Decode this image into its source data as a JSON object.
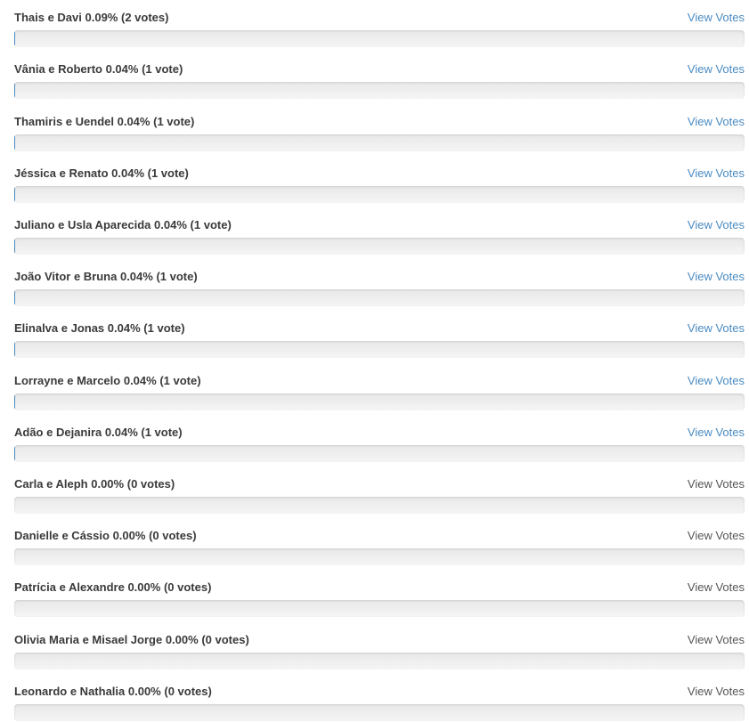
{
  "view_votes_label": "View Votes",
  "colors": {
    "link": "#4a8bc2",
    "disabled_link": "#555555",
    "label": "#3a3a3a",
    "bar_bg": "#eeeeee"
  },
  "options": [
    {
      "name": "Thais e Davi",
      "percent_text": "0.09%",
      "votes_text": "(2 votes)",
      "percent": 0.09,
      "has_votes": true
    },
    {
      "name": "Vânia e Roberto",
      "percent_text": "0.04%",
      "votes_text": "(1 vote)",
      "percent": 0.04,
      "has_votes": true
    },
    {
      "name": "Thamiris e Uendel",
      "percent_text": "0.04%",
      "votes_text": "(1 vote)",
      "percent": 0.04,
      "has_votes": true
    },
    {
      "name": "Jéssica e Renato",
      "percent_text": "0.04%",
      "votes_text": "(1 vote)",
      "percent": 0.04,
      "has_votes": true
    },
    {
      "name": "Juliano e Usla Aparecida",
      "percent_text": "0.04%",
      "votes_text": "(1 vote)",
      "percent": 0.04,
      "has_votes": true
    },
    {
      "name": "João Vitor e Bruna",
      "percent_text": "0.04%",
      "votes_text": "(1 vote)",
      "percent": 0.04,
      "has_votes": true
    },
    {
      "name": "Elinalva e Jonas",
      "percent_text": "0.04%",
      "votes_text": "(1 vote)",
      "percent": 0.04,
      "has_votes": true
    },
    {
      "name": "Lorrayne e Marcelo",
      "percent_text": "0.04%",
      "votes_text": "(1 vote)",
      "percent": 0.04,
      "has_votes": true
    },
    {
      "name": "Adão e Dejanira",
      "percent_text": "0.04%",
      "votes_text": "(1 vote)",
      "percent": 0.04,
      "has_votes": true
    },
    {
      "name": "Carla e Aleph",
      "percent_text": "0.00%",
      "votes_text": "(0 votes)",
      "percent": 0.0,
      "has_votes": false
    },
    {
      "name": "Danielle e Cássio",
      "percent_text": "0.00%",
      "votes_text": "(0 votes)",
      "percent": 0.0,
      "has_votes": false
    },
    {
      "name": "Patrícia e Alexandre",
      "percent_text": "0.00%",
      "votes_text": "(0 votes)",
      "percent": 0.0,
      "has_votes": false
    },
    {
      "name": "Olivia Maria e Misael Jorge",
      "percent_text": "0.00%",
      "votes_text": "(0 votes)",
      "percent": 0.0,
      "has_votes": false
    },
    {
      "name": "Leonardo e Nathalia",
      "percent_text": "0.00%",
      "votes_text": "(0 votes)",
      "percent": 0.0,
      "has_votes": false
    }
  ]
}
